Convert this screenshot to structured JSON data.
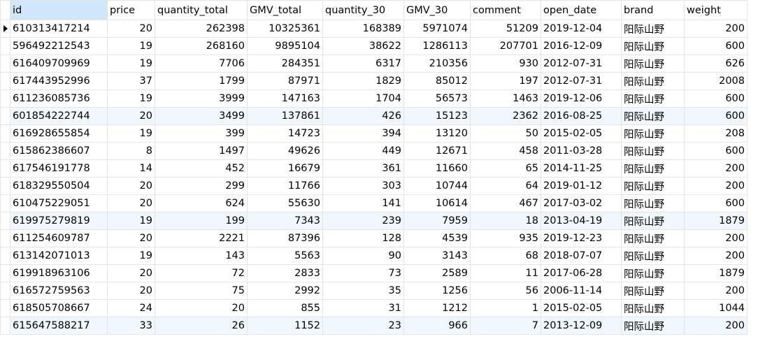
{
  "columns": [
    "id",
    "price",
    "quantity_total",
    "GMV_total",
    "quantity_30",
    "GMV_30",
    "comment",
    "open_date",
    "brand",
    "weight"
  ],
  "colors": {
    "selected_header": "#cfe6fb",
    "alt_row": "#f1f7fe",
    "grid_line": "#e4e4e4"
  },
  "current_row_marker": "row-pointer-icon",
  "rows": [
    {
      "id": "610313417214",
      "price": "20",
      "quantity_total": "262398",
      "GMV_total": "10325361",
      "quantity_30": "168389",
      "GMV_30": "5971074",
      "comment": "51209",
      "open_date": "2019-12-04",
      "brand": "阳际山野",
      "weight": "200"
    },
    {
      "id": "596492212543",
      "price": "19",
      "quantity_total": "268160",
      "GMV_total": "9895104",
      "quantity_30": "38622",
      "GMV_30": "1286113",
      "comment": "207701",
      "open_date": "2016-12-09",
      "brand": "阳际山野",
      "weight": "600"
    },
    {
      "id": "616409709969",
      "price": "19",
      "quantity_total": "7706",
      "GMV_total": "284351",
      "quantity_30": "6317",
      "GMV_30": "210356",
      "comment": "930",
      "open_date": "2012-07-31",
      "brand": "阳际山野",
      "weight": "626"
    },
    {
      "id": "617443952996",
      "price": "37",
      "quantity_total": "1799",
      "GMV_total": "87971",
      "quantity_30": "1829",
      "GMV_30": "85012",
      "comment": "197",
      "open_date": "2012-07-31",
      "brand": "阳际山野",
      "weight": "2008"
    },
    {
      "id": "611236085736",
      "price": "19",
      "quantity_total": "3999",
      "GMV_total": "147163",
      "quantity_30": "1704",
      "GMV_30": "56573",
      "comment": "1463",
      "open_date": "2019-12-06",
      "brand": "阳际山野",
      "weight": "600"
    },
    {
      "id": "601854222744",
      "price": "20",
      "quantity_total": "3499",
      "GMV_total": "137861",
      "quantity_30": "426",
      "GMV_30": "15123",
      "comment": "2362",
      "open_date": "2016-08-25",
      "brand": "阳际山野",
      "weight": "600"
    },
    {
      "id": "616928655854",
      "price": "19",
      "quantity_total": "399",
      "GMV_total": "14723",
      "quantity_30": "394",
      "GMV_30": "13120",
      "comment": "50",
      "open_date": "2015-02-05",
      "brand": "阳际山野",
      "weight": "208"
    },
    {
      "id": "615862386607",
      "price": "8",
      "quantity_total": "1497",
      "GMV_total": "49626",
      "quantity_30": "449",
      "GMV_30": "12671",
      "comment": "458",
      "open_date": "2011-03-28",
      "brand": "阳际山野",
      "weight": "600"
    },
    {
      "id": "617546191778",
      "price": "14",
      "quantity_total": "452",
      "GMV_total": "16679",
      "quantity_30": "361",
      "GMV_30": "11660",
      "comment": "65",
      "open_date": "2014-11-25",
      "brand": "阳际山野",
      "weight": "200"
    },
    {
      "id": "618329550504",
      "price": "20",
      "quantity_total": "299",
      "GMV_total": "11766",
      "quantity_30": "303",
      "GMV_30": "10744",
      "comment": "64",
      "open_date": "2019-01-12",
      "brand": "阳际山野",
      "weight": "200"
    },
    {
      "id": "610475229051",
      "price": "20",
      "quantity_total": "624",
      "GMV_total": "55630",
      "quantity_30": "141",
      "GMV_30": "10614",
      "comment": "467",
      "open_date": "2017-03-02",
      "brand": "阳际山野",
      "weight": "600"
    },
    {
      "id": "619975279819",
      "price": "19",
      "quantity_total": "199",
      "GMV_total": "7343",
      "quantity_30": "239",
      "GMV_30": "7959",
      "comment": "18",
      "open_date": "2013-04-19",
      "brand": "阳际山野",
      "weight": "1879"
    },
    {
      "id": "611254609787",
      "price": "20",
      "quantity_total": "2221",
      "GMV_total": "87396",
      "quantity_30": "128",
      "GMV_30": "4539",
      "comment": "935",
      "open_date": "2019-12-23",
      "brand": "阳际山野",
      "weight": "200"
    },
    {
      "id": "613142071013",
      "price": "19",
      "quantity_total": "143",
      "GMV_total": "5563",
      "quantity_30": "90",
      "GMV_30": "3143",
      "comment": "68",
      "open_date": "2018-07-07",
      "brand": "阳际山野",
      "weight": "200"
    },
    {
      "id": "619918963106",
      "price": "20",
      "quantity_total": "72",
      "GMV_total": "2833",
      "quantity_30": "73",
      "GMV_30": "2589",
      "comment": "11",
      "open_date": "2017-06-28",
      "brand": "阳际山野",
      "weight": "1879"
    },
    {
      "id": "616572759563",
      "price": "20",
      "quantity_total": "75",
      "GMV_total": "2992",
      "quantity_30": "35",
      "GMV_30": "1256",
      "comment": "56",
      "open_date": "2006-11-14",
      "brand": "阳际山野",
      "weight": "200"
    },
    {
      "id": "618505708667",
      "price": "24",
      "quantity_total": "20",
      "GMV_total": "855",
      "quantity_30": "31",
      "GMV_30": "1212",
      "comment": "1",
      "open_date": "2015-02-05",
      "brand": "阳际山野",
      "weight": "1044"
    },
    {
      "id": "615647588217",
      "price": "33",
      "quantity_total": "26",
      "GMV_total": "1152",
      "quantity_30": "23",
      "GMV_30": "966",
      "comment": "7",
      "open_date": "2013-12-09",
      "brand": "阳际山野",
      "weight": "200"
    }
  ]
}
